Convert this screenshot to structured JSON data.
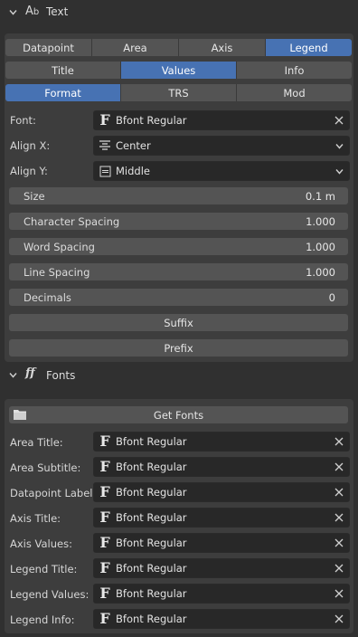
{
  "text_section": {
    "title": "Text",
    "icon": "text-icon"
  },
  "tabs_row1": [
    "Datapoint",
    "Area",
    "Axis",
    "Legend"
  ],
  "tabs_row2": [
    "Title",
    "Values",
    "Info"
  ],
  "tabs_row3": [
    "Format",
    "TRS",
    "Mod"
  ],
  "active": {
    "row1": "Legend",
    "row2": "Values",
    "row3": "Format"
  },
  "font": {
    "label": "Font:",
    "value": "Bfont Regular"
  },
  "align_x": {
    "label": "Align X:",
    "value": "Center"
  },
  "align_y": {
    "label": "Align Y:",
    "value": "Middle"
  },
  "numbers": [
    {
      "label": "Size",
      "value": "0.1 m"
    },
    {
      "label": "Character Spacing",
      "value": "1.000"
    },
    {
      "label": "Word Spacing",
      "value": "1.000"
    },
    {
      "label": "Line Spacing",
      "value": "1.000"
    },
    {
      "label": "Decimals",
      "value": "0"
    }
  ],
  "buttons": {
    "suffix": "Suffix",
    "prefix": "Prefix"
  },
  "fonts_section": {
    "title": "Fonts",
    "get_fonts": "Get Fonts"
  },
  "font_rows": [
    {
      "label": "Area Title:",
      "value": "Bfont Regular"
    },
    {
      "label": "Area Subtitle:",
      "value": "Bfont Regular"
    },
    {
      "label": "Datapoint Label:",
      "value": "Bfont Regular"
    },
    {
      "label": "Axis Title:",
      "value": "Bfont Regular"
    },
    {
      "label": "Axis Values:",
      "value": "Bfont Regular"
    },
    {
      "label": "Legend Title:",
      "value": "Bfont Regular"
    },
    {
      "label": "Legend Values:",
      "value": "Bfont Regular"
    },
    {
      "label": "Legend Info:",
      "value": "Bfont Regular"
    }
  ],
  "colors": {
    "accent": "#4772b3",
    "panel": "#3d3d3d",
    "background": "#303030"
  }
}
